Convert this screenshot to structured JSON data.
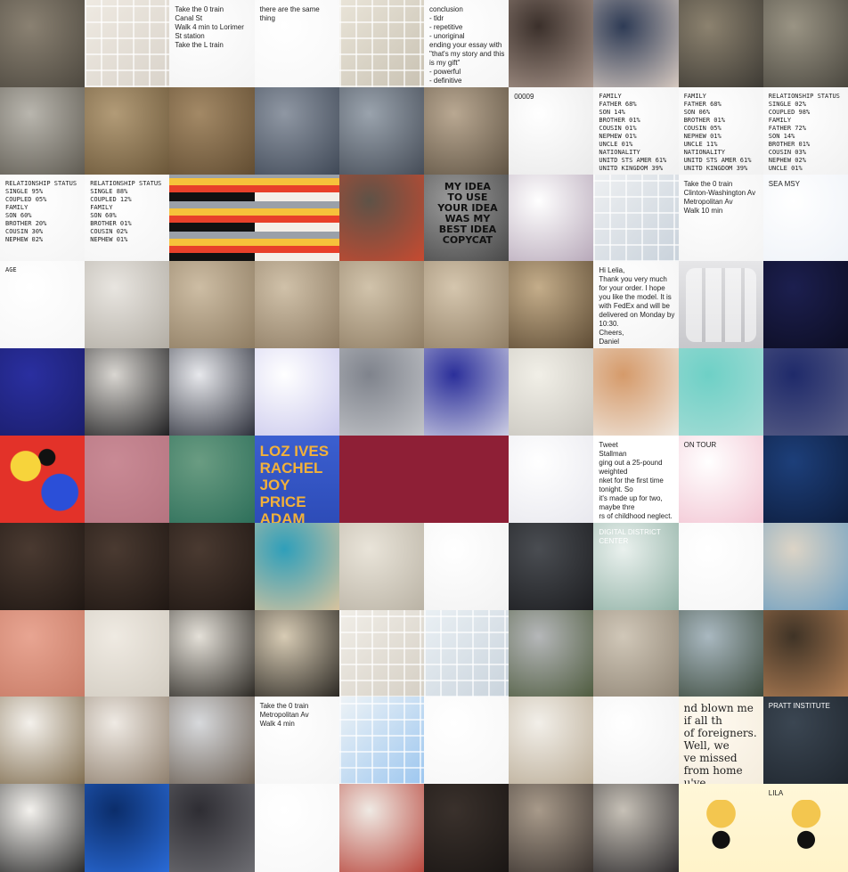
{
  "gallery": {
    "cols": 10,
    "rows": 10,
    "tiles": [
      {
        "kind": "photo",
        "bg": [
          "#8a8172",
          "#4d483f"
        ],
        "text": ""
      },
      {
        "kind": "map",
        "bg": [
          "#efeae2",
          "#d9d3ca"
        ],
        "text": ""
      },
      {
        "kind": "doc",
        "bg": [
          "#ffffff",
          "#f3f3f3"
        ],
        "text": "Take the 0 train\nCanal St\nWalk 4 min to Lorimer St station\nTake the L train"
      },
      {
        "kind": "doc",
        "bg": [
          "#ffffff",
          "#f7f7f7"
        ],
        "text": "there are the same thing"
      },
      {
        "kind": "map",
        "bg": [
          "#e9e4d8",
          "#c9c2b3"
        ],
        "text": ""
      },
      {
        "kind": "doc",
        "bg": [
          "#ffffff",
          "#f5f5f5"
        ],
        "text": "conclusion\n- tldr\n- repetitive\n- unoriginal\nending your essay with \"that's my story and this is my gift\"\n- powerful\n- definitive"
      },
      {
        "kind": "photo",
        "bg": [
          "#3b302b",
          "#a8958a"
        ],
        "text": ""
      },
      {
        "kind": "photo",
        "bg": [
          "#2e3b55",
          "#d6c9c0"
        ],
        "text": ""
      },
      {
        "kind": "photo",
        "bg": [
          "#8c826f",
          "#3d3a34"
        ],
        "text": ""
      },
      {
        "kind": "photo",
        "bg": [
          "#9a9484",
          "#4a473f"
        ],
        "text": ""
      },
      {
        "kind": "photo",
        "bg": [
          "#b9b6ae",
          "#5e5a51"
        ],
        "text": ""
      },
      {
        "kind": "photo",
        "bg": [
          "#b29b77",
          "#6a5638"
        ],
        "text": ""
      },
      {
        "kind": "photo",
        "bg": [
          "#a38966",
          "#614c31"
        ],
        "text": ""
      },
      {
        "kind": "photo",
        "bg": [
          "#8f97a3",
          "#3f4856"
        ],
        "text": ""
      },
      {
        "kind": "photo",
        "bg": [
          "#9aa3ad",
          "#444b56"
        ],
        "text": ""
      },
      {
        "kind": "photo",
        "bg": [
          "#b9a892",
          "#5f5343"
        ],
        "text": ""
      },
      {
        "kind": "doc",
        "bg": [
          "#ffffff",
          "#e9e9e9"
        ],
        "text": "00009"
      },
      {
        "kind": "doc",
        "bg": [
          "#ffffff",
          "#f1f1f1"
        ],
        "text": "FAMILY\nFATHER 68%\nSON 14%\nBROTHER 01%\nCOUSIN 01%\nNEPHEW 01%\nUNCLE 01%\nNATIONALITY\nUNITD STS AMER 61%\nUNITD KINGDOM 39%"
      },
      {
        "kind": "doc",
        "bg": [
          "#ffffff",
          "#f1f1f1"
        ],
        "text": "FAMILY\nFATHER 68%\nSON 06%\nBROTHER 01%\nCOUSIN 05%\nNEPHEW 01%\nUNCLE 11%\nNATIONALITY\nUNITD STS AMER 61%\nUNITD KINGDOM 39%"
      },
      {
        "kind": "doc",
        "bg": [
          "#ffffff",
          "#f1f1f1"
        ],
        "text": "RELATIONSHIP STATUS\nSINGLE 02%\nCOUPLED 98%\nFAMILY\nFATHER 72%\nSON 14%\nBROTHER 01%\nCOUSIN 03%\nNEPHEW 02%\nUNCLE 01%"
      },
      {
        "kind": "doc",
        "bg": [
          "#ffffff",
          "#f4f4f4"
        ],
        "text": "RELATIONSHIP STATUS\nSINGLE 95%\nCOUPLED 05%\nFAMILY\nSON 60%\nBROTHER 20%\nCOUSIN 30%\nNEPHEW 02%"
      },
      {
        "kind": "doc",
        "bg": [
          "#ffffff",
          "#f4f4f4"
        ],
        "text": "RELATIONSHIP STATUS\nSINGLE 88%\nCOUPLED 12%\nFAMILY\nSON 60%\nBROTHER 01%\nCOUSIN 02%\nNEPHEW 01%"
      },
      {
        "kind": "stripes",
        "bg": [
          "#111111",
          "#e8402a"
        ],
        "text": ""
      },
      {
        "kind": "stripes",
        "bg": [
          "#f4efe8",
          "#e8402a"
        ],
        "text": ""
      },
      {
        "kind": "photo",
        "bg": [
          "#5e5247",
          "#c94a30"
        ],
        "text": ""
      },
      {
        "kind": "shirt",
        "bg": [
          "#9c9c9c",
          "#474747"
        ],
        "text": "MY IDEA\nTO USE\nYOUR IDEA\nWAS MY\nBEST IDEA\nCOPYCAT"
      },
      {
        "kind": "doc",
        "bg": [
          "#ffffff",
          "#b6a7b8"
        ],
        "text": ""
      },
      {
        "kind": "map",
        "bg": [
          "#eef0f2",
          "#c9d2db"
        ],
        "text": ""
      },
      {
        "kind": "doc",
        "bg": [
          "#ffffff",
          "#f3f3f3"
        ],
        "text": "Take the 0 train\nClinton-Washington Av\nMetropolitan Av\nWalk 10 min"
      },
      {
        "kind": "doc",
        "bg": [
          "#ffffff",
          "#eef2f8"
        ],
        "text": "SEA  MSY"
      },
      {
        "kind": "doc",
        "bg": [
          "#ffffff",
          "#f6f6f6"
        ],
        "text": "AGE"
      },
      {
        "kind": "photo",
        "bg": [
          "#e8e5e0",
          "#b1aca3"
        ],
        "text": ""
      },
      {
        "kind": "photo",
        "bg": [
          "#cdbda4",
          "#8d7b61"
        ],
        "text": ""
      },
      {
        "kind": "photo",
        "bg": [
          "#d0c1a9",
          "#8c7a62"
        ],
        "text": ""
      },
      {
        "kind": "photo",
        "bg": [
          "#d1c3ab",
          "#8e7c63"
        ],
        "text": ""
      },
      {
        "kind": "photo",
        "bg": [
          "#d5c6ae",
          "#8f7d64"
        ],
        "text": ""
      },
      {
        "kind": "photo",
        "bg": [
          "#c4ad8a",
          "#5c4a33"
        ],
        "text": ""
      },
      {
        "kind": "doc",
        "bg": [
          "#ffffff",
          "#f3f3f3"
        ],
        "text": "Hi Lelia,\nThank you very much for your order. I hope you like the model. It is with FedEx and will be delivered on Monday by 10:30.\nCheers,\nDaniel"
      },
      {
        "kind": "ui",
        "bg": [
          "#e6e6e8",
          "#c7c7cb"
        ],
        "text": ""
      },
      {
        "kind": "blur",
        "bg": [
          "#1c1f4f",
          "#0c0d22"
        ],
        "text": ""
      },
      {
        "kind": "blur",
        "bg": [
          "#2a2fa0",
          "#1a1d6a"
        ],
        "text": ""
      },
      {
        "kind": "blur",
        "bg": [
          "#d9d6d1",
          "#1d1d1f"
        ],
        "text": ""
      },
      {
        "kind": "blur",
        "bg": [
          "#e7e8ec",
          "#2c2f3a"
        ],
        "text": ""
      },
      {
        "kind": "blur",
        "bg": [
          "#ffffff",
          "#c9c7ec"
        ],
        "text": ""
      },
      {
        "kind": "blur",
        "bg": [
          "#7f838c",
          "#c4c6ca"
        ],
        "text": ""
      },
      {
        "kind": "blur",
        "bg": [
          "#2b2f9a",
          "#cfd0e4"
        ],
        "text": ""
      },
      {
        "kind": "blur",
        "bg": [
          "#f1efe7",
          "#c7c4bd"
        ],
        "text": ""
      },
      {
        "kind": "blur",
        "bg": [
          "#d59a6a",
          "#f0e9e1"
        ],
        "text": ""
      },
      {
        "kind": "blur",
        "bg": [
          "#6ed0c6",
          "#a8ddd6"
        ],
        "text": ""
      },
      {
        "kind": "blur",
        "bg": [
          "#1f2a6a",
          "#5a5f86"
        ],
        "text": ""
      },
      {
        "kind": "blobs",
        "bg": [
          "#e33229",
          "#2b4fd8"
        ],
        "text": ""
      },
      {
        "kind": "blur",
        "bg": [
          "#c98a95",
          "#b57480"
        ],
        "text": ""
      },
      {
        "kind": "blur",
        "bg": [
          "#6a9c82",
          "#2d6f5a"
        ],
        "text": ""
      },
      {
        "kind": "poster",
        "bg": [
          "#3b5fd0",
          "#2d4cb8"
        ],
        "text": "LOZ IVES\nRACHEL JOY\nPRICE\nADAM HAYES"
      },
      {
        "kind": "flat",
        "bg": [
          "#8e1f36",
          "#8a1c33"
        ],
        "text": ""
      },
      {
        "kind": "flat",
        "bg": [
          "#8e1f36",
          "#8a1c33"
        ],
        "text": ""
      },
      {
        "kind": "doc",
        "bg": [
          "#ffffff",
          "#e8e8ee"
        ],
        "text": ""
      },
      {
        "kind": "doc",
        "bg": [
          "#ffffff",
          "#ffffff"
        ],
        "text": "Tweet\nStallman\nging out a 25-pound weighted\nnket for the first time tonight. So\nit's made up for two, maybe thre\nrs of childhood neglect."
      },
      {
        "kind": "doc",
        "bg": [
          "#ffffff",
          "#f2c4d2"
        ],
        "text": "ON TOUR"
      },
      {
        "kind": "blur",
        "bg": [
          "#1d3f7a",
          "#0d1d3d"
        ],
        "text": ""
      },
      {
        "kind": "photo",
        "bg": [
          "#4a3a31",
          "#1f1713"
        ],
        "text": ""
      },
      {
        "kind": "photo",
        "bg": [
          "#4a3a31",
          "#1f1713"
        ],
        "text": ""
      },
      {
        "kind": "photo",
        "bg": [
          "#4a3a31",
          "#1f1713"
        ],
        "text": ""
      },
      {
        "kind": "photo",
        "bg": [
          "#2f9fba",
          "#d8c39e"
        ],
        "text": ""
      },
      {
        "kind": "doc",
        "bg": [
          "#e9e4d9",
          "#b9b2a4"
        ],
        "text": ""
      },
      {
        "kind": "doc",
        "bg": [
          "#ffffff",
          "#f2f2f2"
        ],
        "text": ""
      },
      {
        "kind": "photo",
        "bg": [
          "#4a4d52",
          "#1c1d20"
        ],
        "text": ""
      },
      {
        "kind": "doc",
        "bg": [
          "#eaf1ee",
          "#8fb0a4"
        ],
        "text": "DIGITAL DISTRICT CENTER"
      },
      {
        "kind": "doc",
        "bg": [
          "#ffffff",
          "#f5f5f5"
        ],
        "text": ""
      },
      {
        "kind": "photo",
        "bg": [
          "#dcd4c6",
          "#6f9fc0"
        ],
        "text": ""
      },
      {
        "kind": "photo",
        "bg": [
          "#e8a592",
          "#c77a65"
        ],
        "text": ""
      },
      {
        "kind": "doc",
        "bg": [
          "#efeae2",
          "#d1cbc0"
        ],
        "text": ""
      },
      {
        "kind": "photo",
        "bg": [
          "#e4e0d8",
          "#2a2722"
        ],
        "text": ""
      },
      {
        "kind": "photo",
        "bg": [
          "#d7cbb4",
          "#2a2722"
        ],
        "text": ""
      },
      {
        "kind": "map",
        "bg": [
          "#f1eee8",
          "#d5cfc4"
        ],
        "text": ""
      },
      {
        "kind": "map",
        "bg": [
          "#eaf0f4",
          "#c9d3dc"
        ],
        "text": ""
      },
      {
        "kind": "photo",
        "bg": [
          "#b5b7b9",
          "#4d5a3d"
        ],
        "text": ""
      },
      {
        "kind": "photo",
        "bg": [
          "#d0c7b8",
          "#8e8373"
        ],
        "text": ""
      },
      {
        "kind": "photo",
        "bg": [
          "#a9b8c0",
          "#3c4a3c"
        ],
        "text": ""
      },
      {
        "kind": "photo",
        "bg": [
          "#3f3326",
          "#b27f55"
        ],
        "text": ""
      },
      {
        "kind": "photo",
        "bg": [
          "#f4f1ec",
          "#7e6b4d"
        ],
        "text": ""
      },
      {
        "kind": "photo",
        "bg": [
          "#efeae4",
          "#8d7d6b"
        ],
        "text": ""
      },
      {
        "kind": "photo",
        "bg": [
          "#d7d9dc",
          "#6a5e52"
        ],
        "text": ""
      },
      {
        "kind": "doc",
        "bg": [
          "#ffffff",
          "#f4f4f4"
        ],
        "text": "Take the 0 train\nMetropolitan Av\nWalk 4 min"
      },
      {
        "kind": "map",
        "bg": [
          "#eef3f6",
          "#9cc6ef"
        ],
        "text": ""
      },
      {
        "kind": "doc",
        "bg": [
          "#ffffff",
          "#f6f6f6"
        ],
        "text": ""
      },
      {
        "kind": "photo",
        "bg": [
          "#f2efe9",
          "#b9ab95"
        ],
        "text": ""
      },
      {
        "kind": "doc",
        "bg": [
          "#ffffff",
          "#efefef"
        ],
        "text": ""
      },
      {
        "kind": "doc",
        "bg": [
          "#fffaf0",
          "#f4ecdd"
        ],
        "text": "nd blown me if all th\nof foreigners. Well, we\nve missed from home\nu've obviously never\nd Dhatt, unbidden, p\nwas years ago, you"
      },
      {
        "kind": "doc",
        "bg": [
          "#3b4652",
          "#1f262e"
        ],
        "text": "PRATT INSTITUTE"
      },
      {
        "kind": "photo",
        "bg": [
          "#f4f2ee",
          "#2b2b2b"
        ],
        "text": ""
      },
      {
        "kind": "photo",
        "bg": [
          "#0b2d6a",
          "#2a6bd8"
        ],
        "text": ""
      },
      {
        "kind": "photo",
        "bg": [
          "#2e2d33",
          "#6d6d72"
        ],
        "text": ""
      },
      {
        "kind": "doc",
        "bg": [
          "#ffffff",
          "#f7f7f7"
        ],
        "text": ""
      },
      {
        "kind": "photo",
        "bg": [
          "#efeae4",
          "#b8463c"
        ],
        "text": ""
      },
      {
        "kind": "photo",
        "bg": [
          "#3a312c",
          "#1a1614"
        ],
        "text": ""
      },
      {
        "kind": "photo",
        "bg": [
          "#a89a8a",
          "#3b3430"
        ],
        "text": ""
      },
      {
        "kind": "photo",
        "bg": [
          "#c7c1b7",
          "#2e2c2e"
        ],
        "text": ""
      },
      {
        "kind": "drawing",
        "bg": [
          "#fff7d8",
          "#fff3c9"
        ],
        "text": ""
      },
      {
        "kind": "drawing",
        "bg": [
          "#fff7d8",
          "#fff3c9"
        ],
        "text": "LILA"
      }
    ]
  }
}
